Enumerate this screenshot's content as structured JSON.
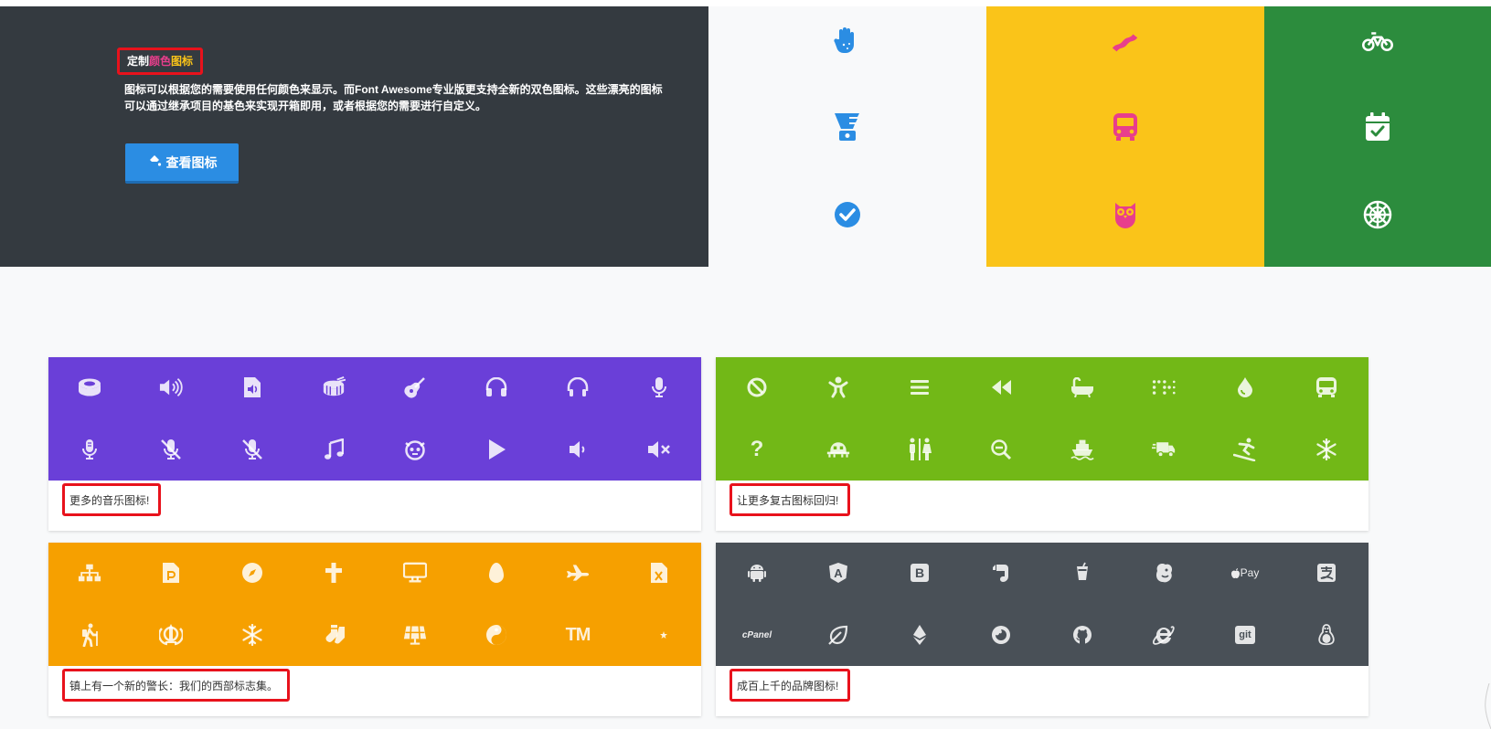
{
  "hero": {
    "title_part1": "定制",
    "title_part2": "颜色",
    "title_part3": "图标",
    "description": "图标可以根据您的需要使用任何颜色来显示。而Font Awesome专业版更支持全新的双色图标。这些漂亮的图标可以通过继承项目的基色来实现开箱即用，或者根据您的需要进行自定义。",
    "button_label": "查看图标",
    "button_icon": "paint-bucket-icon"
  },
  "colors": {
    "dark": "#343a40",
    "blue": "#2b8de3",
    "yellow": "#fac419",
    "green": "#2c8c3d",
    "pink": "#e83e8c",
    "purple": "#6a3fd8",
    "lime": "#72b817",
    "orange": "#f6a000",
    "slate": "#495057",
    "highlight": "#e8121c"
  },
  "color_columns": [
    {
      "name": "white-column",
      "icons": [
        "hand-sparkles-icon",
        "blender-icon",
        "check-circle-icon"
      ]
    },
    {
      "name": "yellow-column",
      "icons": [
        "bacon-icon",
        "bus-icon",
        "owl-icon"
      ]
    },
    {
      "name": "green-column",
      "icons": [
        "bicycle-icon",
        "calendar-check-icon",
        "galactic-empire-icon"
      ]
    }
  ],
  "cards": [
    {
      "name": "music",
      "caption": "更多的音乐图标!",
      "icons": [
        "drum-steelpan-icon",
        "volume-up-icon",
        "file-audio-icon",
        "drum-icon",
        "guitar-icon",
        "headphones-icon",
        "headphones-alt-icon",
        "microphone-icon",
        "microphone-alt-icon",
        "microphone-slash-icon",
        "microphone-alt-slash-icon",
        "music-icon",
        "napster-icon",
        "play-icon",
        "volume-down-icon",
        "volume-mute-icon"
      ]
    },
    {
      "name": "retro",
      "caption": "让更多复古图标回归!",
      "icons": [
        "ban-icon",
        "child-icon",
        "bars-icon",
        "backward-icon",
        "bath-icon",
        "braille-icon",
        "tint-icon",
        "bus-icon",
        "question-icon",
        "space-invader-icon",
        "restroom-icon",
        "search-minus-icon",
        "ship-icon",
        "shipping-fast-icon",
        "snowboarding-icon",
        "snowflake-icon"
      ]
    },
    {
      "name": "western",
      "caption": "镇上有一个新的警长：我们的西部标志集。",
      "icons": [
        "sitemap-icon",
        "file-powerpoint-icon",
        "compass-icon",
        "cross-icon",
        "desktop-icon",
        "egg-icon",
        "plane-icon",
        "file-excel-icon",
        "hiking-icon",
        "khanda-icon",
        "snowflake-icon",
        "socks-icon",
        "solar-panel-icon",
        "yin-yang-icon",
        "trademark-icon",
        "star-and-crescent-icon"
      ]
    },
    {
      "name": "brands",
      "caption": "成百上千的品牌图标!",
      "icons": [
        "android-icon",
        "angular-icon",
        "bootstrap-icon",
        "evernote-icon",
        "cocktail-icon",
        "mailchimp-icon",
        "apple-pay-icon",
        "alipay-icon",
        "cpanel-icon",
        "leaf-icon",
        "ethereum-icon",
        "firefox-icon",
        "github-icon",
        "internet-explorer-icon",
        "git-icon",
        "linux-icon"
      ]
    }
  ],
  "brand_text": {
    "apple_pay": "Pay",
    "cpanel": "cPanel",
    "git": "git",
    "bootstrap": "B",
    "angular": "A",
    "trademark": "TM",
    "question": "?"
  }
}
